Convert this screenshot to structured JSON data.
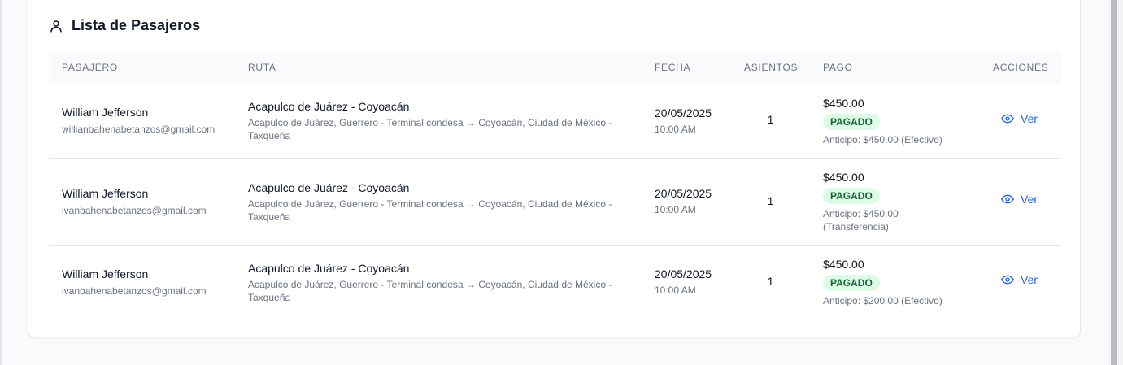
{
  "header": {
    "title": "Lista de Pasajeros",
    "icon": "user-icon"
  },
  "table": {
    "columns": [
      "PASAJERO",
      "RUTA",
      "FECHA",
      "ASIENTOS",
      "PAGO",
      "ACCIONES"
    ],
    "rows": [
      {
        "name": "William Jefferson",
        "email": "willianbahenabetanzos@gmail.com",
        "route_title": "Acapulco de Juárez - Coyoacán",
        "route_detail": "Acapulco de Juárez, Guerrero - Terminal condesa → Coyoacán, Ciudad de México - Taxqueña",
        "date": "20/05/2025",
        "time": "10:00 AM",
        "seats": "1",
        "amount": "$450.00",
        "status": "PAGADO",
        "advance": "Anticipo: $450.00 (Efectivo)",
        "action": "Ver"
      },
      {
        "name": "William Jefferson",
        "email": "ivanbahenabetanzos@gmail.com",
        "route_title": "Acapulco de Juárez - Coyoacán",
        "route_detail": "Acapulco de Juárez, Guerrero - Terminal condesa → Coyoacán, Ciudad de México - Taxqueña",
        "date": "20/05/2025",
        "time": "10:00 AM",
        "seats": "1",
        "amount": "$450.00",
        "status": "PAGADO",
        "advance": "Anticipo: $450.00 (Transferencia)",
        "action": "Ver"
      },
      {
        "name": "William Jefferson",
        "email": "ivanbahenabetanzos@gmail.com",
        "route_title": "Acapulco de Juárez - Coyoacán",
        "route_detail": "Acapulco de Juárez, Guerrero - Terminal condesa → Coyoacán, Ciudad de México - Taxqueña",
        "date": "20/05/2025",
        "time": "10:00 AM",
        "seats": "1",
        "amount": "$450.00",
        "status": "PAGADO",
        "advance": "Anticipo: $200.00 (Efectivo)",
        "action": "Ver"
      }
    ]
  },
  "colors": {
    "accent": "#2563eb",
    "status_paid_bg": "#dcfce7",
    "status_paid_text": "#166534"
  }
}
